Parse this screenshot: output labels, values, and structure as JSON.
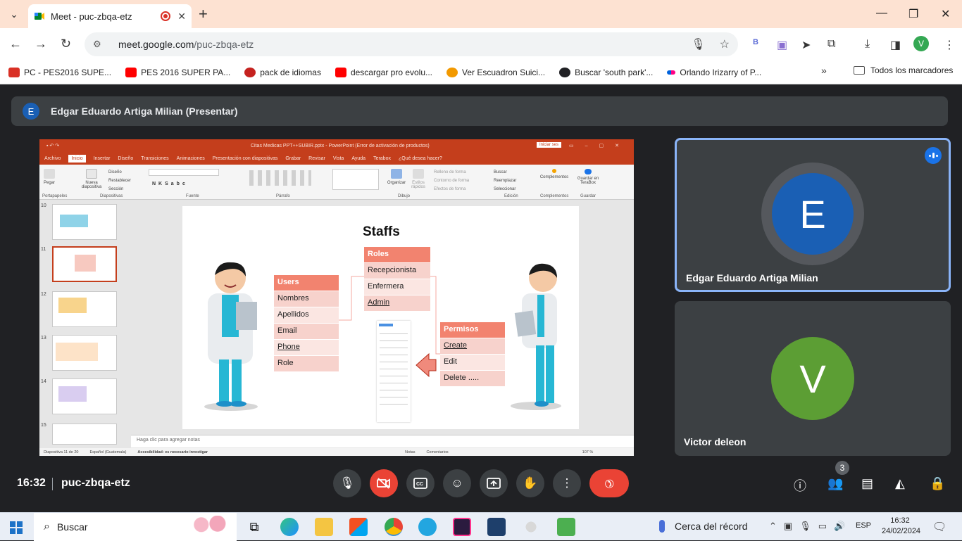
{
  "browser": {
    "tab_title": "Meet - puc-zbqa-etz",
    "url_host": "meet.google.com",
    "url_path": "/puc-zbqa-etz",
    "profile_initial": "V",
    "bookmarks": [
      {
        "label": "PC - PES2016 SUPE...",
        "color": "#d93025"
      },
      {
        "label": "PES 2016 SUPER PA...",
        "color": "#ff0000"
      },
      {
        "label": "pack de idiomas",
        "color": "#c5221f"
      },
      {
        "label": "descargar pro evolu...",
        "color": "#ff0000"
      },
      {
        "label": "Ver Escuadron Suici...",
        "color": "#f29900"
      },
      {
        "label": "Buscar 'south park'...",
        "color": "#202124"
      },
      {
        "label": "Orlando Irizarry of P...",
        "color": "#e91e63"
      }
    ],
    "all_bookmarks_label": "Todos los marcadores"
  },
  "meet": {
    "presenter_initial": "E",
    "presenter_label": "Edgar Eduardo Artiga Milian (Presentar)",
    "participants": [
      {
        "initial": "E",
        "name": "Edgar Eduardo Artiga Milian",
        "color": "#1a5fb4"
      },
      {
        "initial": "V",
        "name": "Victor deleon",
        "color": "#5c9e34"
      }
    ],
    "clock": "16:32",
    "meeting_code": "puc-zbqa-etz",
    "people_count": "3"
  },
  "powerpoint": {
    "doc_title": "Citas Medicas PPT++SUBIR.pptx - PowerPoint (Error de activación de productos)",
    "login": "Iniciar ses",
    "menu": [
      "Archivo",
      "Inicio",
      "Insertar",
      "Diseño",
      "Transiciones",
      "Animaciones",
      "Presentación con diapositivas",
      "Grabar",
      "Revisar",
      "Vista",
      "Ayuda",
      "Terabox",
      "¿Qué desea hacer?"
    ],
    "ribbon_groups": [
      "Portapapeles",
      "Diapositivas",
      "Fuente",
      "Párrafo",
      "Dibujo",
      "Edición",
      "Complementos",
      "Guardar"
    ],
    "ribbon_items": [
      "Pegar",
      "Nueva diapositiva",
      "Diseño",
      "Restablecer",
      "Sección",
      "Organizar",
      "Estilos rápidos",
      "Relleno de forma",
      "Contorno de forma",
      "Efectos de forma",
      "Buscar",
      "Reemplazar",
      "Seleccionar",
      "Complementos",
      "Guardar en TeraBox"
    ],
    "slide_numbers": [
      "10",
      "11",
      "12",
      "13",
      "14",
      "15"
    ],
    "notes_placeholder": "Haga clic para agregar notas",
    "status": [
      "Diapositiva 11 de 20",
      "Español (Guatemala)",
      "Accesibilidad: es necesario investigar",
      "Notas",
      "Comentarios",
      "107 %"
    ],
    "slide": {
      "title": "Staffs",
      "users_header": "Users",
      "users_rows": [
        "Nombres",
        "Apellidos",
        "Email",
        "Phone",
        "Role"
      ],
      "roles_header": "Roles",
      "roles_rows": [
        "Recepcionista",
        "Enfermera",
        "Admin"
      ],
      "permisos_header": "Permisos",
      "permisos_rows": [
        "Create",
        "Edit",
        "Delete ....."
      ]
    }
  },
  "taskbar": {
    "search_placeholder": "Buscar",
    "weather": "Cerca del récord",
    "lang": "ESP",
    "time": "16:32",
    "date": "24/02/2024"
  }
}
